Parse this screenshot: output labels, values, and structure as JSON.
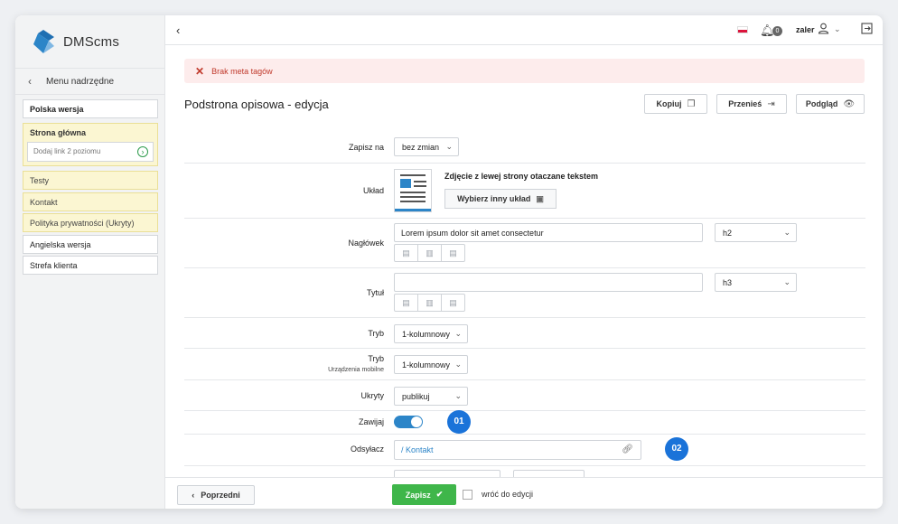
{
  "app": {
    "logo_text": "DMScms"
  },
  "sidebar": {
    "back_label": "Menu nadrzędne",
    "items": [
      {
        "label": "Polska wersja"
      },
      {
        "label": "Strona główna"
      },
      {
        "label": "Dodaj link 2 poziomu"
      },
      {
        "label": "Testy"
      },
      {
        "label": "Kontakt"
      },
      {
        "label": "Polityka prywatności (Ukryty)"
      },
      {
        "label": "Angielska wersja"
      },
      {
        "label": "Strefa klienta"
      }
    ]
  },
  "topbar": {
    "notification_count": "0",
    "user_name": "zaler"
  },
  "alert": {
    "text": "Brak meta tagów"
  },
  "page": {
    "title": "Podstrona opisowa - edycja",
    "actions": {
      "copy": "Kopiuj",
      "move": "Przenieś",
      "preview": "Podgląd"
    }
  },
  "form": {
    "save_to": {
      "label": "Zapisz na",
      "value": "bez zmian"
    },
    "layout": {
      "label": "Układ",
      "name": "Zdjęcie z lewej strony otaczane tekstem",
      "button": "Wybierz inny układ"
    },
    "heading": {
      "label": "Nagłówek",
      "value": "Lorem ipsum dolor sit amet consectetur",
      "level": "h2"
    },
    "title": {
      "label": "Tytuł",
      "value": "",
      "level": "h3"
    },
    "mode": {
      "label": "Tryb",
      "value": "1-kolumnowy"
    },
    "mode_mobile": {
      "label": "Tryb",
      "sublabel": "Urządzenia mobilne",
      "value": "1-kolumnowy"
    },
    "hidden": {
      "label": "Ukryty",
      "value": "publikuj"
    },
    "wrap": {
      "label": "Zawijaj",
      "on": true
    },
    "link": {
      "label": "Odsyłacz",
      "value": "/ Kontakt"
    }
  },
  "markers": {
    "m1": "01",
    "m2": "02"
  },
  "footer": {
    "prev": "Poprzedni",
    "save": "Zapisz",
    "return_label": "wróć do edycji"
  }
}
